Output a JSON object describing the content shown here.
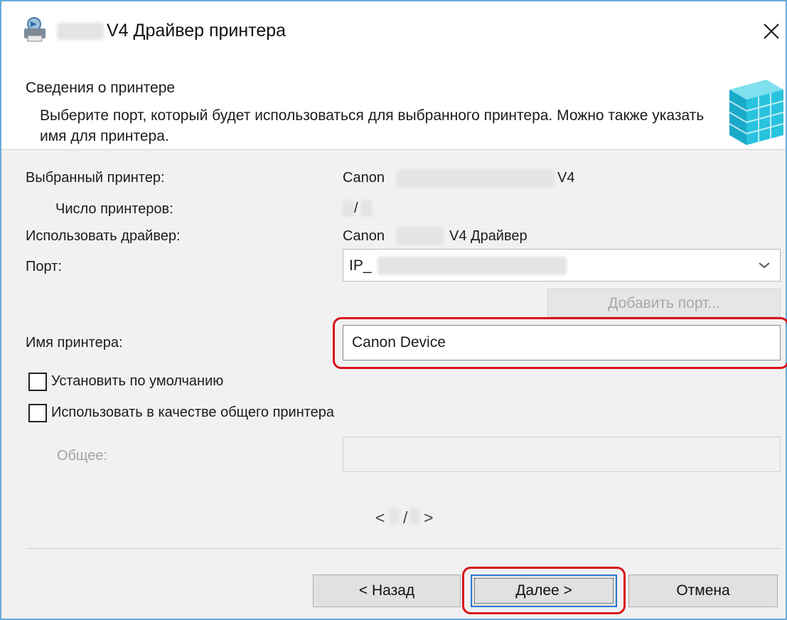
{
  "window": {
    "title": "V4 Драйвер принтера"
  },
  "header": {
    "title": "Сведения о принтере",
    "description": "Выберите порт, который будет использоваться для выбранного принтера. Можно также указать имя для принтера."
  },
  "form": {
    "selected_printer": {
      "label": "Выбранный принтер:",
      "value_prefix": "Canon",
      "value_suffix": "V4"
    },
    "printer_count": {
      "label": "Число принтеров:",
      "value": "/"
    },
    "driver": {
      "label": "Использовать драйвер:",
      "value_prefix": "Canon",
      "value_suffix": "V4 Драйвер"
    },
    "port": {
      "label": "Порт:",
      "value": "IP_"
    },
    "add_port_label": "Добавить порт...",
    "printer_name": {
      "label": "Имя принтера:",
      "value": "Canon Device"
    },
    "set_default_label": "Установить по умолчанию",
    "share_label": "Использовать в качестве общего принтера",
    "share_name": {
      "label": "Общее:",
      "value": ""
    }
  },
  "pager": {
    "prev": "<",
    "current": "/",
    "next": ">"
  },
  "footer": {
    "back_label": "< Назад",
    "next_label": "Далее >",
    "cancel_label": "Отмена"
  },
  "colors": {
    "highlight": "#d9121a",
    "window_border": "#6aa9d8",
    "icon_teal": "#29b8d6"
  },
  "icons": [
    "printer-setup-icon",
    "close-icon",
    "printer-cube-icon",
    "dropdown-arrow-icon"
  ]
}
